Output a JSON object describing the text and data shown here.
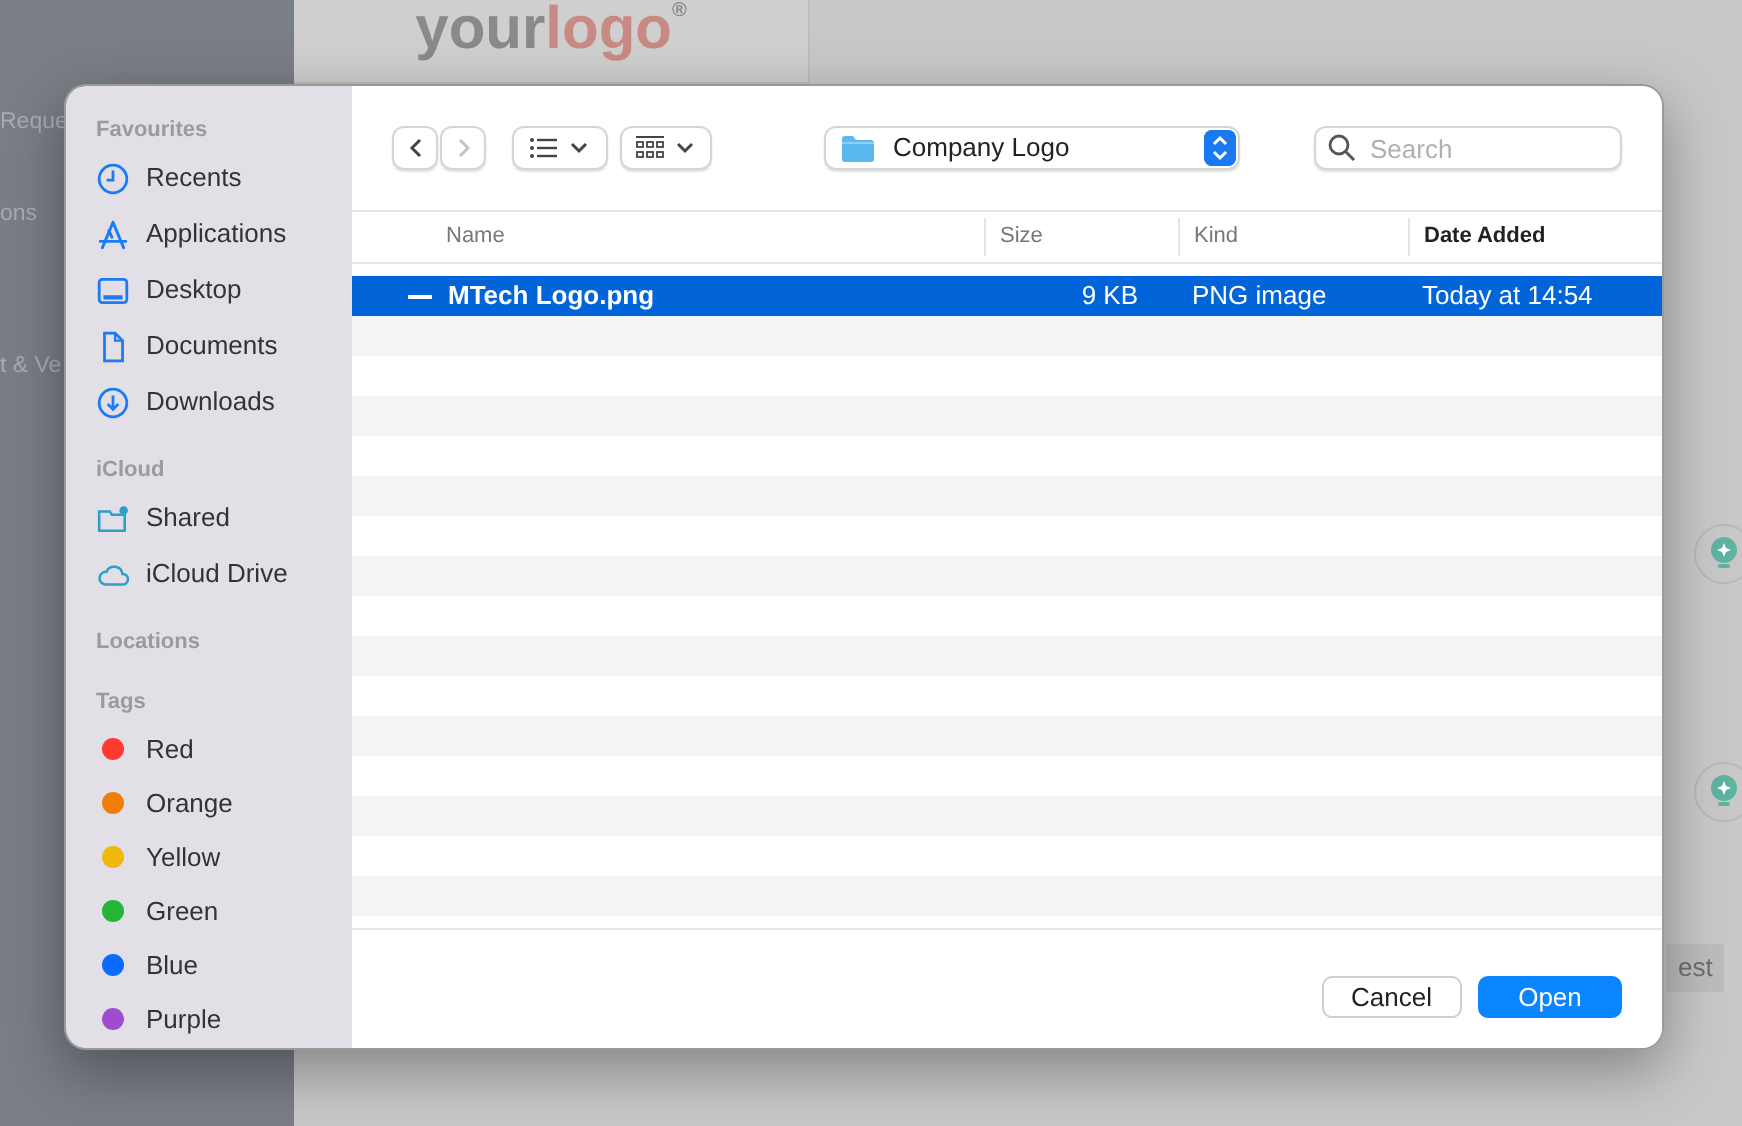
{
  "background": {
    "sidebar_texts": [
      "Reque",
      "ons",
      "t & Ve"
    ],
    "logo": {
      "text": "your",
      "accent": "logo",
      "mark": "®"
    },
    "chip_text": "est"
  },
  "dialog": {
    "sidebar": {
      "sections": [
        {
          "title": "Favourites",
          "items": [
            {
              "label": "Recents",
              "kind": "clock"
            },
            {
              "label": "Applications",
              "kind": "apps"
            },
            {
              "label": "Desktop",
              "kind": "desktop"
            },
            {
              "label": "Documents",
              "kind": "document"
            },
            {
              "label": "Downloads",
              "kind": "download"
            }
          ]
        },
        {
          "title": "iCloud",
          "items": [
            {
              "label": "Shared",
              "kind": "shared"
            },
            {
              "label": "iCloud Drive",
              "kind": "cloud"
            }
          ]
        },
        {
          "title": "Locations"
        },
        {
          "title": "Tags",
          "items": [
            {
              "label": "Red",
              "kind": "tag",
              "color": "#ff3b30"
            },
            {
              "label": "Orange",
              "kind": "tag",
              "color": "#f07f0a"
            },
            {
              "label": "Yellow",
              "kind": "tag",
              "color": "#f0b90c"
            },
            {
              "label": "Green",
              "kind": "tag",
              "color": "#22b536"
            },
            {
              "label": "Blue",
              "kind": "tag",
              "color": "#0a6cff"
            },
            {
              "label": "Purple",
              "kind": "tag",
              "color": "#a04cd0"
            }
          ]
        }
      ]
    },
    "toolbar": {
      "nav": [
        {
          "kind": "back",
          "disabled": false
        },
        {
          "kind": "forward",
          "disabled": true
        }
      ],
      "location": "Company Logo",
      "search": {
        "placeholder": "Search"
      }
    },
    "table": {
      "columns": [
        {
          "label": "Name",
          "sorted": false
        },
        {
          "label": "Size",
          "sorted": false
        },
        {
          "label": "Kind",
          "sorted": false
        },
        {
          "label": "Date Added",
          "sorted": true
        }
      ],
      "rows": [
        {
          "name": "MTech Logo.png",
          "size": "9 KB",
          "kind": "PNG image",
          "date_added": "Today at 14:54",
          "selected": true
        }
      ]
    },
    "buttons": [
      {
        "label": "Cancel",
        "kind": "secondary"
      },
      {
        "label": "Open",
        "kind": "primary"
      }
    ]
  }
}
